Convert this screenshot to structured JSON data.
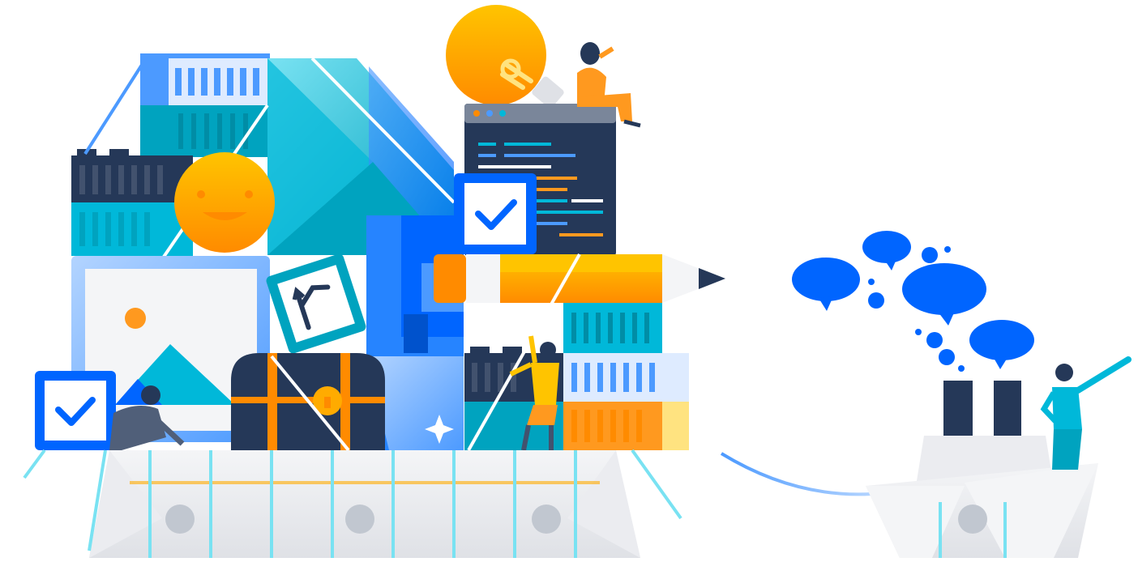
{
  "illustration": {
    "palette": {
      "blue": "#2684ff",
      "deep_blue": "#0052cc",
      "teal": "#00b8d9",
      "dark_navy": "#253858",
      "orange": "#ff8b00",
      "yellow": "#ffab00",
      "light_gray": "#ebecf0",
      "ship_gray": "#dfe1e6"
    },
    "icons": [
      "lightbulb-icon",
      "smiley-icon",
      "code-window-icon",
      "checkbox-icon",
      "pencil-icon",
      "image-icon",
      "branch-icon",
      "treasure-chest-icon",
      "sparkle-icon",
      "speech-bubble-icon",
      "cargo-ship-icon",
      "tugboat-icon"
    ]
  }
}
